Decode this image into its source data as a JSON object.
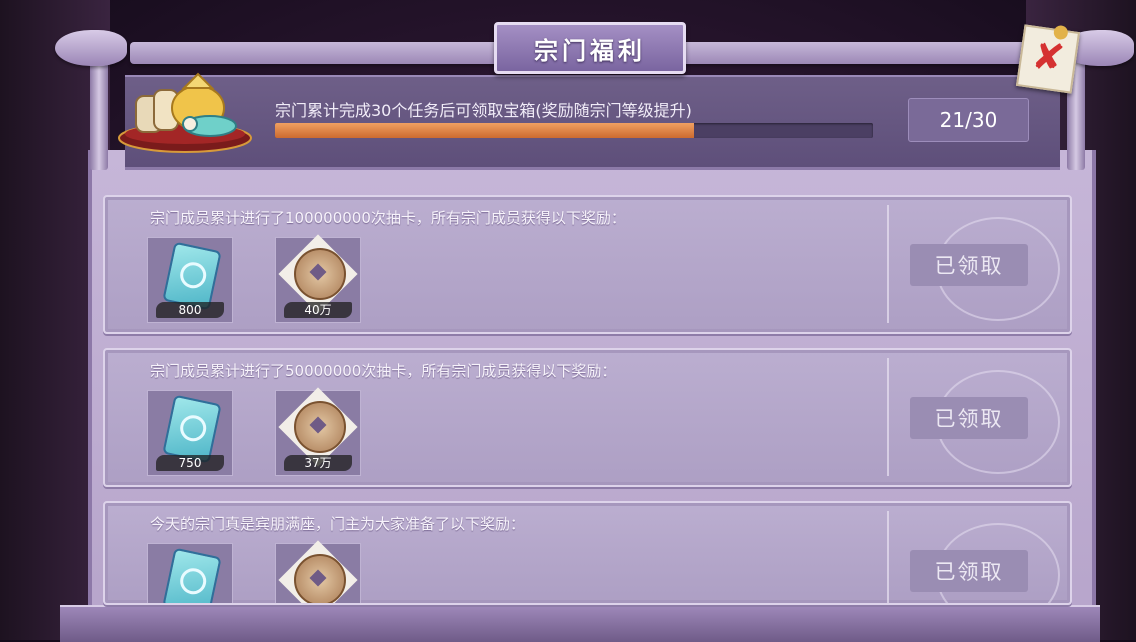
{
  "window": {
    "title": "宗门福利"
  },
  "header": {
    "task_text": "宗门累计完成30个任务后可领取宝箱(奖励随宗门等级提升)",
    "progress": {
      "current": 21,
      "total": 30,
      "fraction": 0.7
    },
    "count_label": "21/30",
    "chest_icon": "treasure-chest-icon"
  },
  "rewards": [
    {
      "text": "宗门成员累计进行了100000000次抽卡，所有宗门成员获得以下奖励：",
      "items": [
        {
          "icon": "summon-ticket-icon",
          "qty": "800"
        },
        {
          "icon": "coin-icon",
          "qty": "40万"
        }
      ],
      "button_label": "已领取"
    },
    {
      "text": "宗门成员累计进行了50000000次抽卡，所有宗门成员获得以下奖励：",
      "items": [
        {
          "icon": "summon-ticket-icon",
          "qty": "750"
        },
        {
          "icon": "coin-icon",
          "qty": "37万"
        }
      ],
      "button_label": "已领取"
    },
    {
      "text": "今天的宗门真是宾朋满座，门主为大家准备了以下奖励：",
      "items": [
        {
          "icon": "summon-ticket-icon",
          "qty": ""
        },
        {
          "icon": "coin-icon",
          "qty": ""
        }
      ],
      "button_label": "已领取"
    }
  ],
  "colors": {
    "progress_fill": "#cc6a2f",
    "panel": "#b7a5cb",
    "close_x": "#d53131"
  }
}
